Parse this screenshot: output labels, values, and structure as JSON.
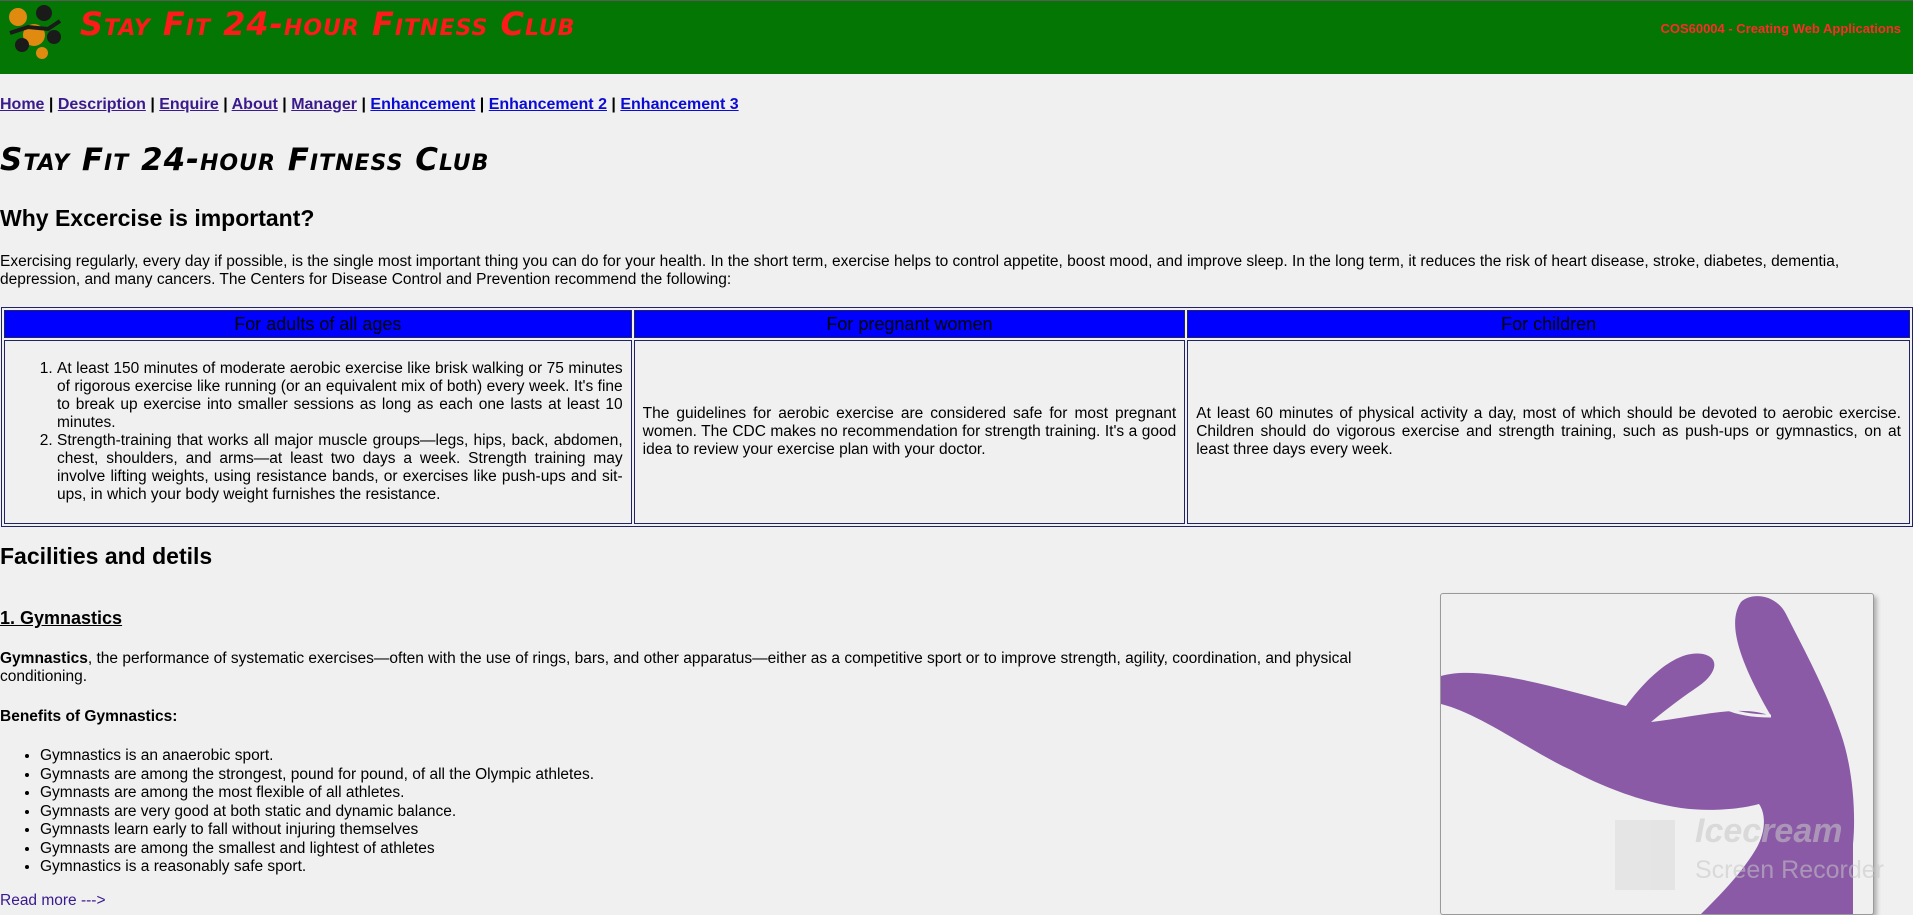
{
  "banner": {
    "title": "Stay Fit 24-hour Fitness Club",
    "course": "COS60004 - Creating Web Applications"
  },
  "nav": {
    "items": [
      "Home",
      "Description",
      "Enquire",
      "About",
      "Manager",
      "Enhancement",
      "Enhancement 2",
      "Enhancement 3"
    ],
    "separator": "|"
  },
  "page": {
    "title": "Stay Fit 24-hour Fitness Club",
    "why_heading": "Why Excercise is important?",
    "intro": "Exercising regularly, every day if possible, is the single most important thing you can do for your health. In the short term, exercise helps to control appetite, boost mood, and improve sleep. In the long term, it reduces the risk of heart disease, stroke, diabetes, dementia, depression, and many cancers. The Centers for Disease Control and Prevention recommend the following:"
  },
  "table": {
    "headers": [
      "For adults of all ages",
      "For pregnant women",
      "For children"
    ],
    "adults": [
      "At least 150 minutes of moderate aerobic exercise like brisk walking or 75 minutes of rigorous exercise like running (or an equivalent mix of both) every week. It's fine to break up exercise into smaller sessions as long as each one lasts at least 10 minutes.",
      "Strength-training that works all major muscle groups—legs, hips, back, abdomen, chest, shoulders, and arms—at least two days a week. Strength training may involve lifting weights, using resistance bands, or exercises like push-ups and sit-ups, in which your body weight furnishes the resistance."
    ],
    "pregnant": "The guidelines for aerobic exercise are considered safe for most pregnant women. The CDC makes no recommendation for strength training. It's a good idea to review your exercise plan with your doctor.",
    "children": "At least 60 minutes of physical activity a day, most of which should be devoted to aerobic exercise. Children should do vigorous exercise and strength training, such as push-ups or gymnastics, on at least three days every week."
  },
  "facilities": {
    "heading": "Facilities and detils",
    "gym_heading": "1. Gymnastics",
    "gym_term": "Gymnastics",
    "gym_desc": ", the performance of systematic exercises—often with the use of rings, bars, and other apparatus—either as a competitive sport or to improve strength, agility, coordination, and physical conditioning.",
    "benefits_title": "Benefits of Gymnastics:",
    "benefits": [
      "Gymnastics is an anaerobic sport.",
      "Gymnasts are among the strongest, pound for pound, of all the Olympic athletes.",
      "Gymnasts are among the most flexible of all athletes.",
      "Gymnasts are very good at both static and dynamic balance.",
      "Gymnasts learn early to fall without injuring themselves",
      "Gymnasts are among the smallest and lightest of athletes",
      "Gymnastics is a reasonably safe sport."
    ],
    "read_more": "Read more --->"
  },
  "watermark": {
    "line1": "Icecream",
    "line2": "Screen Recorder"
  },
  "colors": {
    "banner": "#037603",
    "banner_text": "#ff1a1a",
    "table_header": "#0000ff",
    "figure": "#8a5aa6"
  }
}
